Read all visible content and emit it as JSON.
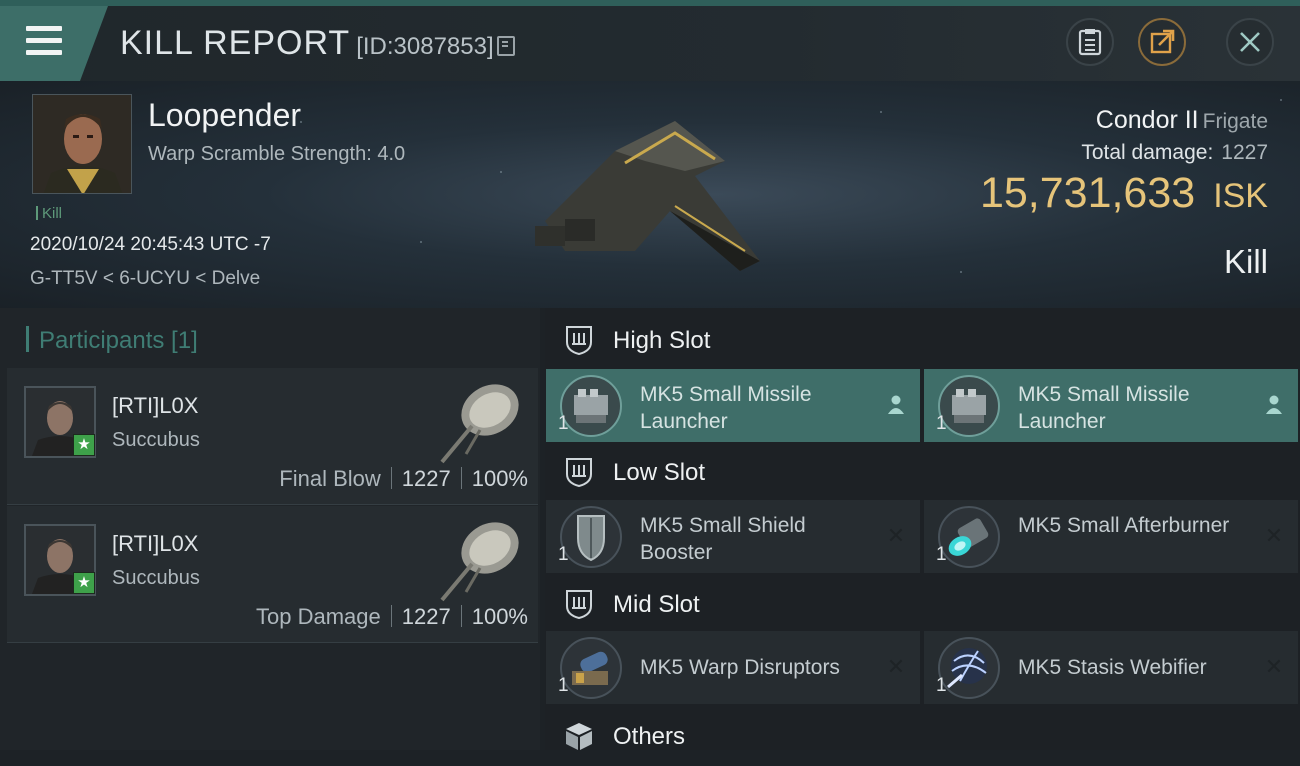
{
  "header": {
    "title": "KILL REPORT",
    "id_text": "[ID:3087853]",
    "accent_color": "#3d6e68"
  },
  "victim": {
    "name": "Loopender",
    "warp_scramble": "Warp Scramble Strength: 4.0",
    "tag": "Kill",
    "datetime": "2020/10/24 20:45:43 UTC -7",
    "location": "G-TT5V < 6-UCYU < Delve",
    "ship_name": "Condor II",
    "ship_class": "Frigate",
    "total_damage_label": "Total damage:",
    "total_damage_value": "1227",
    "isk_value": "15,731,633",
    "isk_unit": "ISK",
    "result": "Kill",
    "isk_color": "#e6c47a"
  },
  "participants": {
    "title": "Participants [1]",
    "rows": [
      {
        "name": "[RTI]L0X",
        "ship": "Succubus",
        "role": "Final Blow",
        "damage": "1227",
        "percent": "100%"
      },
      {
        "name": "[RTI]L0X",
        "ship": "Succubus",
        "role": "Top Damage",
        "damage": "1227",
        "percent": "100%"
      }
    ]
  },
  "slots": {
    "high": {
      "title": "High Slot",
      "items": [
        {
          "name": "MK5 Small Missile Launcher",
          "qty": "1",
          "icon": "missile-launcher-icon",
          "status": "user-icon"
        },
        {
          "name": "MK5 Small Missile Launcher",
          "qty": "1",
          "icon": "missile-launcher-icon",
          "status": "user-icon"
        }
      ]
    },
    "low": {
      "title": "Low Slot",
      "items": [
        {
          "name": "MK5 Small Shield Booster",
          "qty": "1",
          "icon": "shield-booster-icon",
          "status": "destroyed-icon"
        },
        {
          "name": "MK5 Small Afterburner",
          "qty": "1",
          "icon": "afterburner-icon",
          "status": "destroyed-icon"
        }
      ]
    },
    "mid": {
      "title": "Mid Slot",
      "items": [
        {
          "name": "MK5 Warp Disruptors",
          "qty": "1",
          "icon": "warp-disruptor-icon",
          "status": "destroyed-icon"
        },
        {
          "name": "MK5 Stasis Webifier",
          "qty": "1",
          "icon": "stasis-webifier-icon",
          "status": "destroyed-icon"
        }
      ]
    },
    "others": {
      "title": "Others"
    }
  }
}
